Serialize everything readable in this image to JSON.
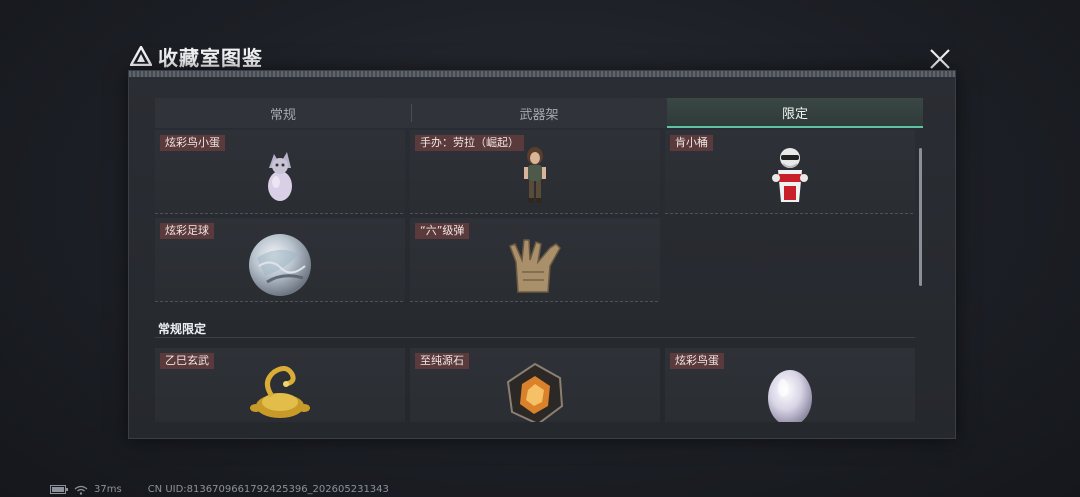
{
  "window": {
    "title": "收藏室图鉴"
  },
  "tabs": [
    {
      "label": "常规",
      "active": false
    },
    {
      "label": "武器架",
      "active": false
    },
    {
      "label": "限定",
      "active": true
    }
  ],
  "items_top": [
    {
      "label": "炫彩鸟小蛋",
      "icon": "egg-creature-icon"
    },
    {
      "label": "手办：劳拉（崛起）",
      "icon": "figure-lara-icon"
    },
    {
      "label": "肯小桶",
      "icon": "bucket-mascot-icon"
    },
    {
      "label": "炫彩足球",
      "icon": "iridescent-ball-icon"
    },
    {
      "label": "“六”级弹",
      "icon": "gold-hand-icon"
    }
  ],
  "section": {
    "title": "常规限定"
  },
  "items_bottom": [
    {
      "label": "乙巳玄武",
      "icon": "golden-tortoise-snake-icon"
    },
    {
      "label": "至纯源石",
      "icon": "dark-crystal-icon"
    },
    {
      "label": "炫彩鸟蛋",
      "icon": "pearl-egg-icon"
    }
  ],
  "status": {
    "ping": "37ms",
    "uid": "CN UID:8136709661792425396_202605231343"
  },
  "colors": {
    "accent": "#5fc2a2",
    "label_bg": "#5b3a3c"
  }
}
